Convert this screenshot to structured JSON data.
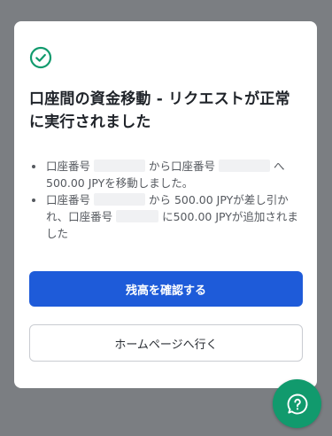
{
  "modal": {
    "title": "口座間の資金移動 - リクエストが正常に実行されました",
    "bullet1": {
      "part1": "口座番号",
      "part2": "から口座番号",
      "part3": "へ500.00 JPYを移動しました。"
    },
    "bullet2": {
      "part1": "口座番号",
      "part2": "から 500.00 JPYが差し引かれ、口座番号",
      "part3": "に500.00 JPYが追加されました"
    },
    "confirm_balance_label": "残高を確認する",
    "home_label": "ホームページへ行く"
  },
  "colors": {
    "success": "#119a6d",
    "primary": "#1e5bd9",
    "overlay": "#7b7e82"
  },
  "icons": {
    "status": "check-circle-icon",
    "help": "help-icon"
  }
}
